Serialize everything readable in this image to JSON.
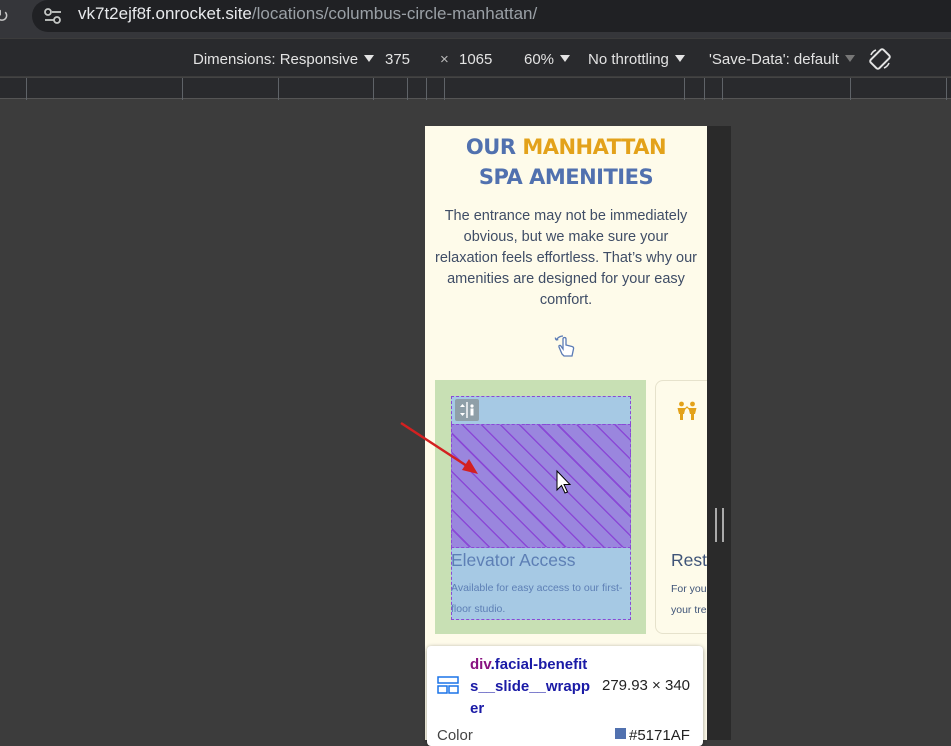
{
  "browser": {
    "url_host": "vk7t2ejf8f.onrocket.site",
    "url_path": "/locations/columbus-circle-manhattan/"
  },
  "device_toolbar": {
    "dimensions_label": "Dimensions: Responsive",
    "width": "375",
    "times": "×",
    "height": "1065",
    "zoom": "60%",
    "throttling": "No throttling",
    "save_data": "'Save-Data': default"
  },
  "page": {
    "title_part1": "OUR",
    "title_accent": "MANHATTAN",
    "title_line2": "SPA AMENITIES",
    "description": "The entrance may not be immediately obvious, but we make sure your relaxation feels effortless. That’s why our amenities are designed for your easy comfort.",
    "colors": {
      "primary": "#5171AF",
      "accent": "#E3A21A",
      "background": "#FEFBEA"
    }
  },
  "cards": [
    {
      "title": "Elevator Access",
      "text": "Available for easy access to our first-floor studio.",
      "icon": "elevator-icon"
    },
    {
      "title": "Rest",
      "text": "For you\nyour tre",
      "icon": "people-icon"
    }
  ],
  "inspector_tooltip": {
    "element": "div",
    "class_name": ".facial-benefits__slide__wrapper",
    "size": "279.93 × 340",
    "color_label": "Color",
    "color_value": "#5171AF"
  }
}
